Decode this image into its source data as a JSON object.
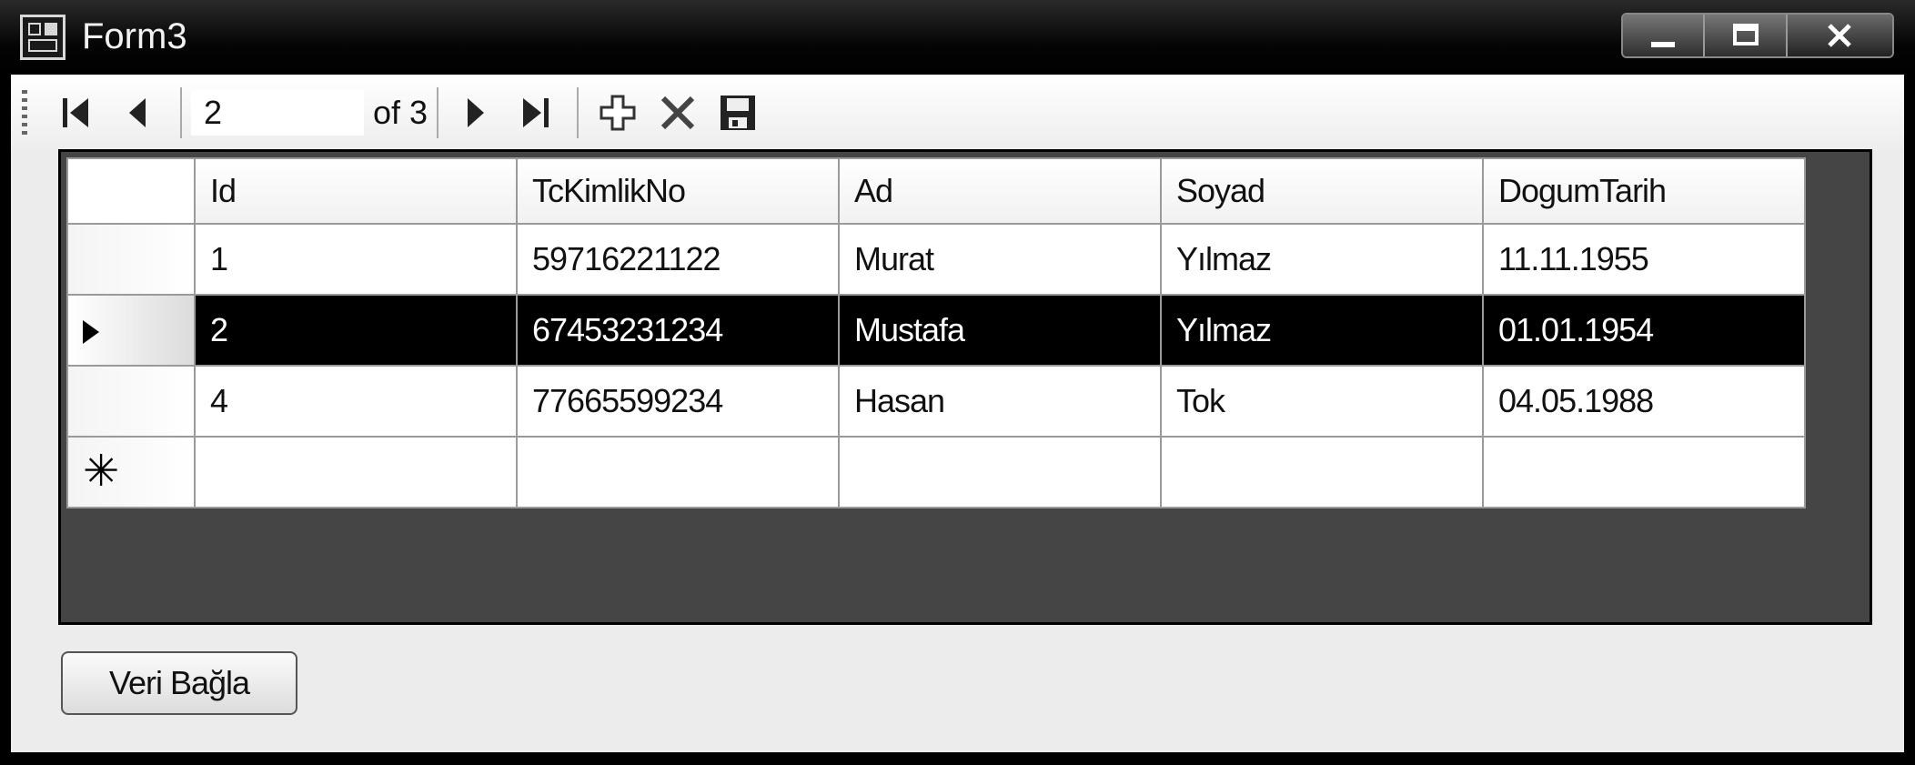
{
  "window": {
    "title": "Form3"
  },
  "navigator": {
    "position": "2",
    "count_label": "of 3",
    "icons": [
      "move-first-icon",
      "move-previous-icon",
      "move-next-icon",
      "move-last-icon",
      "add-new-icon",
      "delete-icon",
      "save-icon"
    ]
  },
  "grid": {
    "columns": [
      "Id",
      "TcKimlikNo",
      "Ad",
      "Soyad",
      "DogumTarih"
    ],
    "rows": [
      [
        "1",
        "59716221122",
        "Murat",
        "Yılmaz",
        "11.11.1955"
      ],
      [
        "2",
        "67453231234",
        "Mustafa",
        "Yılmaz",
        "01.01.1954"
      ],
      [
        "4",
        "77665599234",
        "Hasan",
        "Tok",
        "04.05.1988"
      ]
    ],
    "selected_row": 1,
    "new_row_marker": "✳"
  },
  "actions": {
    "bind_button": "Veri Bağla"
  }
}
